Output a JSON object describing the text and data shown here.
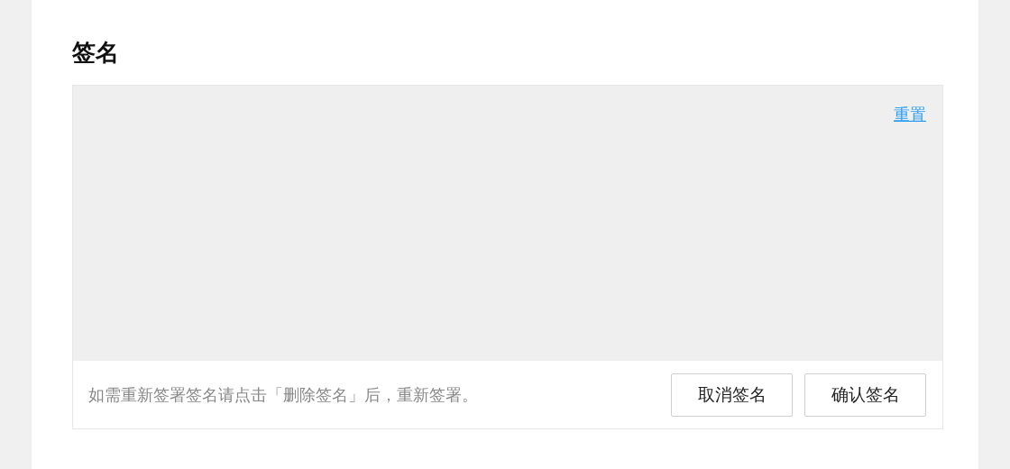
{
  "title": "签名",
  "signature_pad": {
    "reset_link": "重置"
  },
  "footer": {
    "hint": "如需重新签署签名请点击「删除签名」后，重新签署。",
    "buttons": [
      {
        "label": "取消签名"
      },
      {
        "label": "确认签名"
      }
    ]
  }
}
